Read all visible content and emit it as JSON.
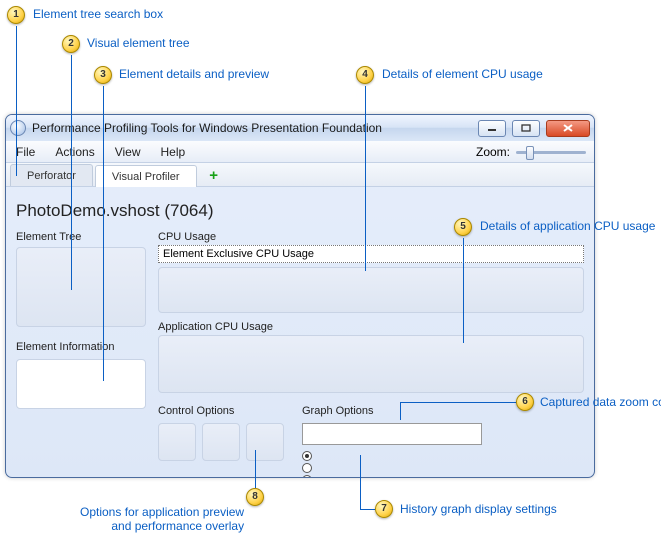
{
  "callouts": {
    "c1": "Element tree search box",
    "c2": "Visual element tree",
    "c3": "Element details and preview",
    "c4": "Details of element CPU usage",
    "c5": "Details of application CPU usage",
    "c6": "Captured data zoom control",
    "c7": "History graph display settings",
    "c8": "Options for application preview\nand performance overlay",
    "n1": "1",
    "n2": "2",
    "n3": "3",
    "n4": "4",
    "n5": "5",
    "n6": "6",
    "n7": "7",
    "n8": "8"
  },
  "window": {
    "title": "Performance Profiling Tools for Windows Presentation Foundation"
  },
  "menu": {
    "file": "File",
    "actions": "Actions",
    "view": "View",
    "help": "Help",
    "zoom": "Zoom:"
  },
  "tabs": {
    "perforator": "Perforator",
    "visual_profiler": "Visual Profiler"
  },
  "process": {
    "title": "PhotoDemo.vshost (7064)"
  },
  "left": {
    "tree_label": "Element Tree",
    "info_label": "Element Information"
  },
  "cpu": {
    "section": "CPU Usage",
    "exclusive": "Element Exclusive CPU Usage",
    "application": "Application CPU Usage"
  },
  "options": {
    "control": "Control Options",
    "graph": "Graph Options"
  }
}
